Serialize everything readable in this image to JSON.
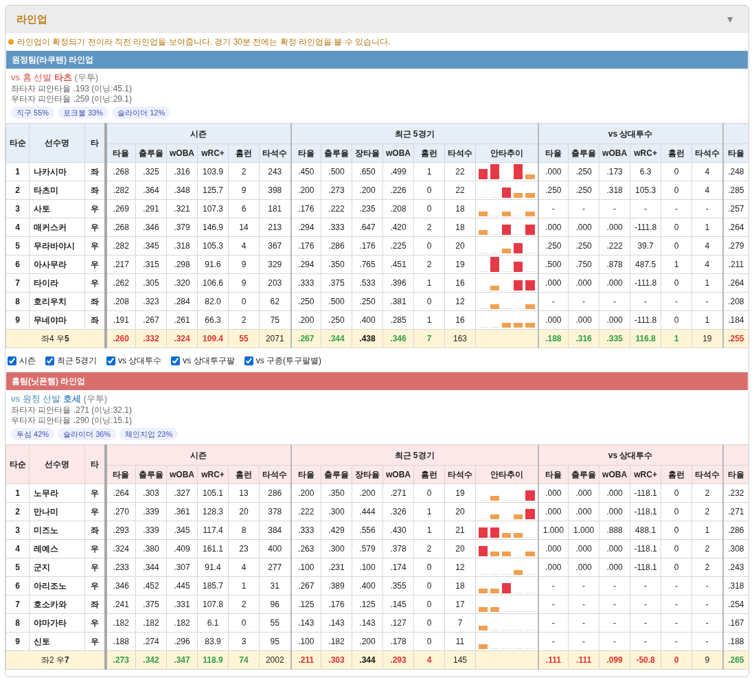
{
  "panel": {
    "title": "라인업",
    "toggle": "▼"
  },
  "notice": "라인업이 확정되기 전이라 직전 라인업을 보여줍니다. 경기 30분 전에는 확정 라인업을 볼 수 있습니다.",
  "away": {
    "heading": "원정팀(라쿠텐) 라인업",
    "pitcher": {
      "prefix": "vs 홈 선발",
      "name": "타츠",
      "hand": "(우투)"
    },
    "split_lines": [
      "좌타자 피안타율 .193 (이닝:45.1)",
      "우타자 피안타율 .259 (이닝:29.1)"
    ],
    "pitch_mix": [
      "직구 55%",
      "포크볼 33%",
      "슬라이더 12%"
    ],
    "table": {
      "lead_columns": [
        "타순",
        "선수명",
        "타"
      ],
      "groups": [
        {
          "label": "시즌",
          "columns": [
            "타율",
            "출루율",
            "wOBA",
            "wRC+",
            "홈런",
            "타석수"
          ]
        },
        {
          "label": "최근 5경기",
          "columns": [
            "타율",
            "출루율",
            "장타율",
            "wOBA",
            "홈런",
            "타석수",
            "안타추이"
          ]
        },
        {
          "label": "vs 상대투수",
          "columns": [
            "타율",
            "출루율",
            "wOBA",
            "wRC+",
            "홈런",
            "타석수"
          ]
        },
        {
          "columns": [
            "타율"
          ]
        }
      ],
      "rows": [
        {
          "order": "1",
          "name": "나카시마",
          "bats": "좌",
          "season": [
            ".268",
            ".325",
            ".316",
            "103.9",
            "2",
            "243"
          ],
          "recent": [
            ".450",
            ".500",
            ".650",
            ".499",
            "1",
            "22"
          ],
          "trend": [
            {
              "kind": "two"
            },
            {
              "kind": "three"
            },
            {
              "kind": "none"
            },
            {
              "kind": "three"
            },
            {
              "kind": "one"
            }
          ],
          "vs": [
            ".000",
            ".250",
            ".173",
            "6.3",
            "0",
            "4"
          ],
          "extra": [
            ".248"
          ]
        },
        {
          "order": "2",
          "name": "타츠미",
          "bats": "좌",
          "season": [
            ".282",
            ".364",
            ".348",
            "125.7",
            "9",
            "398"
          ],
          "recent": [
            ".200",
            ".273",
            ".200",
            ".226",
            "0",
            "22"
          ],
          "trend": [
            {
              "kind": "none"
            },
            {
              "kind": "none"
            },
            {
              "kind": "two"
            },
            {
              "kind": "one"
            },
            {
              "kind": "one"
            }
          ],
          "vs": [
            ".250",
            ".250",
            ".318",
            "105.3",
            "0",
            "4"
          ],
          "extra": [
            ".285"
          ]
        },
        {
          "order": "3",
          "name": "사토",
          "bats": "우",
          "season": [
            ".269",
            ".291",
            ".321",
            "107.3",
            "6",
            "181"
          ],
          "recent": [
            ".176",
            ".222",
            ".235",
            ".208",
            "0",
            "18"
          ],
          "trend": [
            {
              "kind": "one"
            },
            {
              "kind": "none"
            },
            {
              "kind": "one"
            },
            {
              "kind": "none"
            },
            {
              "kind": "one"
            }
          ],
          "vs": [
            "-",
            "-",
            "-",
            "-",
            "-",
            "-"
          ],
          "extra": [
            ".257"
          ]
        },
        {
          "order": "4",
          "name": "매커스커",
          "bats": "우",
          "season": [
            ".268",
            ".346",
            ".379",
            "146.9",
            "14",
            "213"
          ],
          "recent": [
            ".294",
            ".333",
            ".647",
            ".420",
            "2",
            "18"
          ],
          "trend": [
            {
              "kind": "one"
            },
            {
              "kind": "none"
            },
            {
              "kind": "two"
            },
            {
              "kind": "none"
            },
            {
              "kind": "two"
            }
          ],
          "vs": [
            ".000",
            ".000",
            ".000",
            "-111.8",
            "0",
            "1"
          ],
          "extra": [
            ".264"
          ]
        },
        {
          "order": "5",
          "name": "무라바야시",
          "bats": "우",
          "season": [
            ".282",
            ".345",
            ".318",
            "105.3",
            "4",
            "367"
          ],
          "recent": [
            ".176",
            ".286",
            ".176",
            ".225",
            "0",
            "20"
          ],
          "trend": [
            {
              "kind": "none"
            },
            {
              "kind": "none"
            },
            {
              "kind": "one"
            },
            {
              "kind": "two"
            },
            {
              "kind": "none"
            }
          ],
          "vs": [
            ".250",
            ".250",
            ".222",
            "39.7",
            "0",
            "4"
          ],
          "extra": [
            ".279"
          ]
        },
        {
          "order": "6",
          "name": "아사무라",
          "bats": "우",
          "season": [
            ".217",
            ".315",
            ".298",
            "91.6",
            "9",
            "329"
          ],
          "recent": [
            ".294",
            ".350",
            ".765",
            ".451",
            "2",
            "19"
          ],
          "trend": [
            {
              "kind": "none"
            },
            {
              "kind": "three"
            },
            {
              "kind": "none"
            },
            {
              "kind": "two"
            },
            {
              "kind": "none"
            }
          ],
          "vs": [
            ".500",
            ".750",
            ".878",
            "487.5",
            "1",
            "4"
          ],
          "extra": [
            ".211"
          ]
        },
        {
          "order": "7",
          "name": "타이라",
          "bats": "우",
          "season": [
            ".262",
            ".305",
            ".320",
            "106.6",
            "9",
            "203"
          ],
          "recent": [
            ".333",
            ".375",
            ".533",
            ".396",
            "1",
            "16"
          ],
          "trend": [
            {
              "kind": "none"
            },
            {
              "kind": "one"
            },
            {
              "kind": "none"
            },
            {
              "kind": "two"
            },
            {
              "kind": "two"
            }
          ],
          "vs": [
            ".000",
            ".000",
            ".000",
            "-111.8",
            "0",
            "1"
          ],
          "extra": [
            ".264"
          ]
        },
        {
          "order": "8",
          "name": "호리우치",
          "bats": "좌",
          "season": [
            ".208",
            ".323",
            ".284",
            "82.0",
            "0",
            "62"
          ],
          "recent": [
            ".250",
            ".500",
            ".250",
            ".381",
            "0",
            "12"
          ],
          "trend": [
            {
              "kind": "none"
            },
            {
              "kind": "one"
            },
            {
              "kind": "none"
            },
            {
              "kind": "none"
            },
            {
              "kind": "one"
            }
          ],
          "vs": [
            "-",
            "-",
            "-",
            "-",
            "-",
            "-"
          ],
          "extra": [
            ".208"
          ]
        },
        {
          "order": "9",
          "name": "무네야마",
          "bats": "좌",
          "season": [
            ".191",
            ".267",
            ".261",
            "66.3",
            "2",
            "75"
          ],
          "recent": [
            ".200",
            ".250",
            ".400",
            ".285",
            "1",
            "16"
          ],
          "trend": [
            {
              "kind": "none"
            },
            {
              "kind": "none"
            },
            {
              "kind": "one"
            },
            {
              "kind": "one"
            },
            {
              "kind": "one"
            }
          ],
          "vs": [
            ".000",
            ".000",
            ".000",
            "-111.8",
            "0",
            "1"
          ],
          "extra": [
            ".184"
          ]
        }
      ],
      "total": {
        "label": "좌4 우**5**",
        "season": [
          {
            "text": ".260",
            "color": "#e03131",
            "bold": true
          },
          {
            "text": ".332",
            "color": "#e03131",
            "bold": true
          },
          {
            "text": ".324",
            "color": "#e03131",
            "bold": true
          },
          {
            "text": "109.4",
            "color": "#e03131",
            "bold": true
          },
          {
            "text": "55",
            "color": "#e03131",
            "bold": true
          },
          {
            "text": "2071",
            "color": "#222222",
            "bold": false
          }
        ],
        "recent": [
          {
            "text": ".267",
            "color": "#2f9e44",
            "bold": true
          },
          {
            "text": ".344",
            "color": "#2f9e44",
            "bold": true
          },
          {
            "text": ".438",
            "color": "#111111",
            "bold": true
          },
          {
            "text": ".346",
            "color": "#2f9e44",
            "bold": true
          },
          {
            "text": "7",
            "color": "#2f9e44",
            "bold": true
          },
          {
            "text": "163",
            "color": "#222222",
            "bold": false
          }
        ],
        "vs": [
          {
            "text": ".188",
            "color": "#2f9e44",
            "bold": true
          },
          {
            "text": ".316",
            "color": "#2f9e44",
            "bold": true
          },
          {
            "text": ".335",
            "color": "#2f9e44",
            "bold": true
          },
          {
            "text": "116.8",
            "color": "#2f9e44",
            "bold": true
          },
          {
            "text": "1",
            "color": "#2f9e44",
            "bold": true
          },
          {
            "text": "19",
            "color": "#222222",
            "bold": false
          }
        ],
        "extra": [
          {
            "text": ".255",
            "color": "#e03131",
            "bold": true
          }
        ]
      }
    }
  },
  "filters": [
    {
      "label": "시즌",
      "checked": true
    },
    {
      "label": "최근 5경기",
      "checked": true
    },
    {
      "label": "vs 상대투수",
      "checked": true
    },
    {
      "label": "vs 상대투구팔",
      "checked": true
    },
    {
      "label": "vs 구종(투구팔별)",
      "checked": true
    }
  ],
  "home": {
    "heading": "홈팀(닛폰햄) 라인업",
    "pitcher": {
      "prefix": "vs 원정 선발",
      "name": "호세",
      "hand": "(우투)"
    },
    "split_lines": [
      "좌타자 피안타율 .271 (이닝:32.1)",
      "우타자 피안타율 .290 (이닝:15.1)"
    ],
    "pitch_mix": [
      "투심 42%",
      "슬라이더 36%",
      "체인지업 23%"
    ],
    "table": {
      "lead_columns": [
        "타순",
        "선수명",
        "타"
      ],
      "groups": [
        {
          "label": "시즌",
          "columns": [
            "타율",
            "출루율",
            "wOBA",
            "wRC+",
            "홈런",
            "타석수"
          ]
        },
        {
          "label": "최근 5경기",
          "columns": [
            "타율",
            "출루율",
            "장타율",
            "wOBA",
            "홈런",
            "타석수",
            "안타추이"
          ]
        },
        {
          "label": "vs 상대투수",
          "columns": [
            "타율",
            "출루율",
            "wOBA",
            "wRC+",
            "홈런",
            "타석수"
          ]
        },
        {
          "columns": [
            "타율"
          ]
        }
      ],
      "rows": [
        {
          "order": "1",
          "name": "노무라",
          "bats": "우",
          "season": [
            ".264",
            ".303",
            ".327",
            "105.1",
            "13",
            "286"
          ],
          "recent": [
            ".200",
            ".350",
            ".200",
            ".271",
            "0",
            "19"
          ],
          "trend": [
            {
              "kind": "none"
            },
            {
              "kind": "one"
            },
            {
              "kind": "none"
            },
            {
              "kind": "none"
            },
            {
              "kind": "two"
            }
          ],
          "vs": [
            ".000",
            ".000",
            ".000",
            "-118.1",
            "0",
            "2"
          ],
          "extra": [
            ".232"
          ]
        },
        {
          "order": "2",
          "name": "만나미",
          "bats": "우",
          "season": [
            ".270",
            ".339",
            ".361",
            "128.3",
            "20",
            "378"
          ],
          "recent": [
            ".222",
            ".300",
            ".444",
            ".326",
            "1",
            "20"
          ],
          "trend": [
            {
              "kind": "none"
            },
            {
              "kind": "one"
            },
            {
              "kind": "none"
            },
            {
              "kind": "one"
            },
            {
              "kind": "two"
            }
          ],
          "vs": [
            ".000",
            ".000",
            ".000",
            "-118.1",
            "0",
            "2"
          ],
          "extra": [
            ".271"
          ]
        },
        {
          "order": "3",
          "name": "미즈노",
          "bats": "좌",
          "season": [
            ".293",
            ".339",
            ".345",
            "117.4",
            "8",
            "384"
          ],
          "recent": [
            ".333",
            ".429",
            ".556",
            ".430",
            "1",
            "21"
          ],
          "trend": [
            {
              "kind": "two"
            },
            {
              "kind": "two"
            },
            {
              "kind": "one"
            },
            {
              "kind": "one"
            },
            {
              "kind": "none"
            }
          ],
          "vs": [
            "1.000",
            "1.000",
            ".888",
            "488.1",
            "0",
            "1"
          ],
          "extra": [
            ".286"
          ]
        },
        {
          "order": "4",
          "name": "레예스",
          "bats": "우",
          "season": [
            ".324",
            ".380",
            ".409",
            "161.1",
            "23",
            "400"
          ],
          "recent": [
            ".263",
            ".300",
            ".579",
            ".378",
            "2",
            "20"
          ],
          "trend": [
            {
              "kind": "two"
            },
            {
              "kind": "one"
            },
            {
              "kind": "one"
            },
            {
              "kind": "none"
            },
            {
              "kind": "one"
            }
          ],
          "vs": [
            ".000",
            ".000",
            ".000",
            "-118.1",
            "0",
            "2"
          ],
          "extra": [
            ".308"
          ]
        },
        {
          "order": "5",
          "name": "군지",
          "bats": "우",
          "season": [
            ".233",
            ".344",
            ".307",
            "91.4",
            "4",
            "277"
          ],
          "recent": [
            ".100",
            ".231",
            ".100",
            ".174",
            "0",
            "12"
          ],
          "trend": [
            {
              "kind": "none"
            },
            {
              "kind": "none"
            },
            {
              "kind": "none"
            },
            {
              "kind": "one"
            },
            {
              "kind": "none"
            }
          ],
          "vs": [
            ".000",
            ".000",
            ".000",
            "-118.1",
            "0",
            "2"
          ],
          "extra": [
            ".243"
          ]
        },
        {
          "order": "6",
          "name": "아리조노",
          "bats": "우",
          "season": [
            ".346",
            ".452",
            ".445",
            "185.7",
            "1",
            "31"
          ],
          "recent": [
            ".267",
            ".389",
            ".400",
            ".355",
            "0",
            "18"
          ],
          "trend": [
            {
              "kind": "one"
            },
            {
              "kind": "one"
            },
            {
              "kind": "two"
            },
            {
              "kind": "none"
            },
            {
              "kind": "none"
            }
          ],
          "vs": [
            "-",
            "-",
            "-",
            "-",
            "-",
            "-"
          ],
          "extra": [
            ".318"
          ]
        },
        {
          "order": "7",
          "name": "호소카와",
          "bats": "좌",
          "season": [
            ".241",
            ".375",
            ".331",
            "107.8",
            "2",
            "96"
          ],
          "recent": [
            ".125",
            ".176",
            ".125",
            ".145",
            "0",
            "17"
          ],
          "trend": [
            {
              "kind": "one"
            },
            {
              "kind": "one"
            },
            {
              "kind": "none"
            },
            {
              "kind": "none"
            },
            {
              "kind": "none"
            }
          ],
          "vs": [
            "-",
            "-",
            "-",
            "-",
            "-",
            "-"
          ],
          "extra": [
            ".254"
          ]
        },
        {
          "order": "8",
          "name": "야마가타",
          "bats": "우",
          "season": [
            ".182",
            ".182",
            ".182",
            "6.1",
            "0",
            "55"
          ],
          "recent": [
            ".143",
            ".143",
            ".143",
            ".127",
            "0",
            "7"
          ],
          "trend": [
            {
              "kind": "one"
            },
            {
              "kind": "none"
            },
            {
              "kind": "none"
            },
            {
              "kind": "none"
            },
            {
              "kind": "none"
            }
          ],
          "vs": [
            "-",
            "-",
            "-",
            "-",
            "-",
            "-"
          ],
          "extra": [
            ".167"
          ]
        },
        {
          "order": "9",
          "name": "신토",
          "bats": "우",
          "season": [
            ".188",
            ".274",
            ".296",
            "83.9",
            "3",
            "95"
          ],
          "recent": [
            ".100",
            ".182",
            ".200",
            ".178",
            "0",
            "11"
          ],
          "trend": [
            {
              "kind": "one"
            },
            {
              "kind": "none"
            },
            {
              "kind": "none"
            },
            {
              "kind": "none"
            },
            {
              "kind": "none"
            }
          ],
          "vs": [
            "-",
            "-",
            "-",
            "-",
            "-",
            "-"
          ],
          "extra": [
            ".188"
          ]
        }
      ],
      "total": {
        "label": "좌2 우**7**",
        "season": [
          {
            "text": ".273",
            "color": "#2f9e44",
            "bold": true
          },
          {
            "text": ".342",
            "color": "#2f9e44",
            "bold": true
          },
          {
            "text": ".347",
            "color": "#2f9e44",
            "bold": true
          },
          {
            "text": "118.9",
            "color": "#2f9e44",
            "bold": true
          },
          {
            "text": "74",
            "color": "#2f9e44",
            "bold": true
          },
          {
            "text": "2002",
            "color": "#222222",
            "bold": false
          }
        ],
        "recent": [
          {
            "text": ".211",
            "color": "#e03131",
            "bold": true
          },
          {
            "text": ".303",
            "color": "#e03131",
            "bold": true
          },
          {
            "text": ".344",
            "color": "#111111",
            "bold": true
          },
          {
            "text": ".293",
            "color": "#e03131",
            "bold": true
          },
          {
            "text": "4",
            "color": "#e03131",
            "bold": true
          },
          {
            "text": "145",
            "color": "#222222",
            "bold": false
          }
        ],
        "vs": [
          {
            "text": ".111",
            "color": "#e03131",
            "bold": true
          },
          {
            "text": ".111",
            "color": "#e03131",
            "bold": true
          },
          {
            "text": ".099",
            "color": "#e03131",
            "bold": true
          },
          {
            "text": "-50.8",
            "color": "#e03131",
            "bold": true
          },
          {
            "text": "0",
            "color": "#e03131",
            "bold": true
          },
          {
            "text": "9",
            "color": "#222222",
            "bold": false
          }
        ],
        "extra": [
          {
            "text": ".265",
            "color": "#2f9e44",
            "bold": true
          }
        ]
      }
    }
  }
}
